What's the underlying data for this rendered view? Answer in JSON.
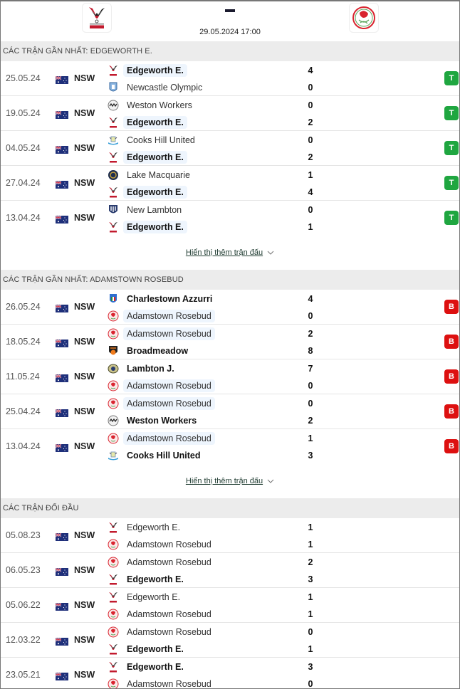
{
  "header": {
    "home_team_logo": "edgeworth-eagles-logo",
    "away_team_logo": "adamstown-rosebud-logo",
    "score_separator": "-",
    "kickoff": "29.05.2024 17:00"
  },
  "colors": {
    "win": "#1fa640",
    "loss": "#dd1010",
    "highlight_bg": "#eef5fd",
    "section_bg": "#ececec"
  },
  "sections": [
    {
      "title": "CÁC TRẬN GẦN NHẤT: EDGEWORTH E.",
      "show_more": "Hiển thị thêm trận đấu",
      "matches": [
        {
          "date": "25.05.24",
          "league": "NSW",
          "home": {
            "name": "Edgeworth E.",
            "icon": "edgeworth",
            "bold": true,
            "hl": true
          },
          "away": {
            "name": "Newcastle Olympic",
            "icon": "newcastle",
            "bold": false,
            "hl": false
          },
          "home_score": "4",
          "away_score": "0",
          "result": "T",
          "result_type": "win"
        },
        {
          "date": "19.05.24",
          "league": "NSW",
          "home": {
            "name": "Weston Workers",
            "icon": "weston",
            "bold": false,
            "hl": false
          },
          "away": {
            "name": "Edgeworth E.",
            "icon": "edgeworth",
            "bold": true,
            "hl": true
          },
          "home_score": "0",
          "away_score": "2",
          "result": "T",
          "result_type": "win"
        },
        {
          "date": "04.05.24",
          "league": "NSW",
          "home": {
            "name": "Cooks Hill United",
            "icon": "cookshill",
            "bold": false,
            "hl": false
          },
          "away": {
            "name": "Edgeworth E.",
            "icon": "edgeworth",
            "bold": true,
            "hl": true
          },
          "home_score": "0",
          "away_score": "2",
          "result": "T",
          "result_type": "win"
        },
        {
          "date": "27.04.24",
          "league": "NSW",
          "home": {
            "name": "Lake Macquarie",
            "icon": "lakemac",
            "bold": false,
            "hl": false
          },
          "away": {
            "name": "Edgeworth E.",
            "icon": "edgeworth",
            "bold": true,
            "hl": true
          },
          "home_score": "1",
          "away_score": "4",
          "result": "T",
          "result_type": "win"
        },
        {
          "date": "13.04.24",
          "league": "NSW",
          "home": {
            "name": "New Lambton",
            "icon": "newlambton",
            "bold": false,
            "hl": false
          },
          "away": {
            "name": "Edgeworth E.",
            "icon": "edgeworth",
            "bold": true,
            "hl": true
          },
          "home_score": "0",
          "away_score": "1",
          "result": "T",
          "result_type": "win"
        }
      ]
    },
    {
      "title": "CÁC TRẬN GẦN NHẤT: ADAMSTOWN ROSEBUD",
      "show_more": "Hiển thị thêm trận đấu",
      "matches": [
        {
          "date": "26.05.24",
          "league": "NSW",
          "home": {
            "name": "Charlestown Azzurri",
            "icon": "charlestown",
            "bold": true,
            "hl": false
          },
          "away": {
            "name": "Adamstown Rosebud",
            "icon": "adamstown",
            "bold": false,
            "hl": true
          },
          "home_score": "4",
          "away_score": "0",
          "result": "B",
          "result_type": "loss"
        },
        {
          "date": "18.05.24",
          "league": "NSW",
          "home": {
            "name": "Adamstown Rosebud",
            "icon": "adamstown",
            "bold": false,
            "hl": true
          },
          "away": {
            "name": "Broadmeadow",
            "icon": "broadmeadow",
            "bold": true,
            "hl": false
          },
          "home_score": "2",
          "away_score": "8",
          "result": "B",
          "result_type": "loss"
        },
        {
          "date": "11.05.24",
          "league": "NSW",
          "home": {
            "name": "Lambton J.",
            "icon": "lambton",
            "bold": true,
            "hl": false
          },
          "away": {
            "name": "Adamstown Rosebud",
            "icon": "adamstown",
            "bold": false,
            "hl": true
          },
          "home_score": "7",
          "away_score": "0",
          "result": "B",
          "result_type": "loss"
        },
        {
          "date": "25.04.24",
          "league": "NSW",
          "home": {
            "name": "Adamstown Rosebud",
            "icon": "adamstown",
            "bold": false,
            "hl": true
          },
          "away": {
            "name": "Weston Workers",
            "icon": "weston",
            "bold": true,
            "hl": false
          },
          "home_score": "0",
          "away_score": "2",
          "result": "B",
          "result_type": "loss"
        },
        {
          "date": "13.04.24",
          "league": "NSW",
          "home": {
            "name": "Adamstown Rosebud",
            "icon": "adamstown",
            "bold": false,
            "hl": true
          },
          "away": {
            "name": "Cooks Hill United",
            "icon": "cookshill",
            "bold": true,
            "hl": false
          },
          "home_score": "1",
          "away_score": "3",
          "result": "B",
          "result_type": "loss"
        }
      ]
    },
    {
      "title": "CÁC TRẬN ĐỐI ĐẦU",
      "matches": [
        {
          "date": "05.08.23",
          "league": "NSW",
          "home": {
            "name": "Edgeworth E.",
            "icon": "edgeworth",
            "bold": false,
            "hl": false
          },
          "away": {
            "name": "Adamstown Rosebud",
            "icon": "adamstown",
            "bold": false,
            "hl": false
          },
          "home_score": "1",
          "away_score": "1"
        },
        {
          "date": "06.05.23",
          "league": "NSW",
          "home": {
            "name": "Adamstown Rosebud",
            "icon": "adamstown",
            "bold": false,
            "hl": false
          },
          "away": {
            "name": "Edgeworth E.",
            "icon": "edgeworth",
            "bold": true,
            "hl": false
          },
          "home_score": "2",
          "away_score": "3"
        },
        {
          "date": "05.06.22",
          "league": "NSW",
          "home": {
            "name": "Edgeworth E.",
            "icon": "edgeworth",
            "bold": false,
            "hl": false
          },
          "away": {
            "name": "Adamstown Rosebud",
            "icon": "adamstown",
            "bold": false,
            "hl": false
          },
          "home_score": "1",
          "away_score": "1"
        },
        {
          "date": "12.03.22",
          "league": "NSW",
          "home": {
            "name": "Adamstown Rosebud",
            "icon": "adamstown",
            "bold": false,
            "hl": false
          },
          "away": {
            "name": "Edgeworth E.",
            "icon": "edgeworth",
            "bold": true,
            "hl": false
          },
          "home_score": "0",
          "away_score": "1"
        },
        {
          "date": "23.05.21",
          "league": "NSW",
          "home": {
            "name": "Edgeworth E.",
            "icon": "edgeworth",
            "bold": true,
            "hl": false
          },
          "away": {
            "name": "Adamstown Rosebud",
            "icon": "adamstown",
            "bold": false,
            "hl": false
          },
          "home_score": "3",
          "away_score": "0"
        }
      ]
    }
  ]
}
